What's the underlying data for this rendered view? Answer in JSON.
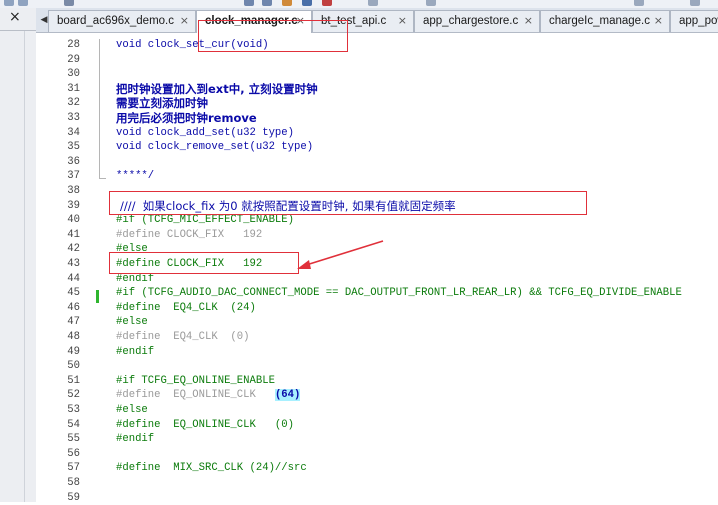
{
  "tabs": [
    {
      "label": "board_ac696x_demo.c",
      "active": false
    },
    {
      "label": "clock_manager.c",
      "active": true
    },
    {
      "label": "bt_test_api.c",
      "active": false
    },
    {
      "label": "app_chargestore.c",
      "active": false
    },
    {
      "label": "chargeIc_manage.c",
      "active": false
    },
    {
      "label": "app_pow",
      "active": false
    }
  ],
  "panel": {
    "close_glyph": "×"
  },
  "tab_close_glyph": "×",
  "tab_scroll_glyph": "◀",
  "lines": [
    {
      "n": "28",
      "text": "void clock_set_cur(void)",
      "style": "blue"
    },
    {
      "n": "29",
      "text": "",
      "style": "blue"
    },
    {
      "n": "30",
      "text": "",
      "style": "blue"
    },
    {
      "n": "31",
      "text": "把时钟设置加入到ext中, 立刻设置时钟",
      "style": "zh"
    },
    {
      "n": "32",
      "text": "需要立刻添加时钟",
      "style": "zh"
    },
    {
      "n": "33",
      "text": "用完后必须把时钟remove",
      "style": "zh"
    },
    {
      "n": "34",
      "text": "void clock_add_set(u32 type)",
      "style": "blue"
    },
    {
      "n": "35",
      "text": "void clock_remove_set(u32 type)",
      "style": "blue"
    },
    {
      "n": "36",
      "text": "",
      "style": "blue"
    },
    {
      "n": "37",
      "text": "*****/",
      "style": "blue"
    },
    {
      "n": "38",
      "text": "",
      "style": "blue"
    },
    {
      "n": "39",
      "text": "////  如果clock_fix 为0 就按照配置设置时钟, 如果有值就固定频率",
      "style": "comment"
    },
    {
      "n": "40",
      "text": "#if (TCFG_MIC_EFFECT_ENABLE)",
      "style": "green"
    },
    {
      "n": "41",
      "text": "#define CLOCK_FIX   192",
      "style": "gray"
    },
    {
      "n": "42",
      "text": "#else",
      "style": "green"
    },
    {
      "n": "43",
      "text": "#define CLOCK_FIX   192",
      "style": "green"
    },
    {
      "n": "44",
      "text": "#endif",
      "style": "green"
    },
    {
      "n": "45",
      "text": "#if (TCFG_AUDIO_DAC_CONNECT_MODE == DAC_OUTPUT_FRONT_LR_REAR_LR) && TCFG_EQ_DIVIDE_ENABLE",
      "style": "green"
    },
    {
      "n": "46",
      "text": "#define  EQ4_CLK  (24)",
      "style": "green"
    },
    {
      "n": "47",
      "text": "#else",
      "style": "green"
    },
    {
      "n": "48",
      "text": "#define  EQ4_CLK  (0)",
      "style": "gray"
    },
    {
      "n": "49",
      "text": "#endif",
      "style": "green"
    },
    {
      "n": "50",
      "text": "",
      "style": "green"
    },
    {
      "n": "51",
      "text": "#if TCFG_EQ_ONLINE_ENABLE",
      "style": "green"
    },
    {
      "n": "52",
      "text": "#define  EQ_ONLINE_CLK   ",
      "style": "gray",
      "hl": "(64)"
    },
    {
      "n": "53",
      "text": "#else",
      "style": "green"
    },
    {
      "n": "54",
      "text": "#define  EQ_ONLINE_CLK   (0)",
      "style": "green"
    },
    {
      "n": "55",
      "text": "#endif",
      "style": "green"
    },
    {
      "n": "56",
      "text": "",
      "style": "green"
    },
    {
      "n": "57",
      "text": "#define  MIX_SRC_CLK (24)//src",
      "style": "green"
    },
    {
      "n": "58",
      "text": "",
      "style": "green"
    },
    {
      "n": "59",
      "text": "",
      "style": "green"
    }
  ],
  "colors": {
    "keyword_blue": "#0a0aa8",
    "preprocessor_green": "#0b7b0b",
    "inactive_gray": "#9a9a9a",
    "annotation_red": "#e0303a",
    "change_marker_green": "#2fb52f"
  }
}
